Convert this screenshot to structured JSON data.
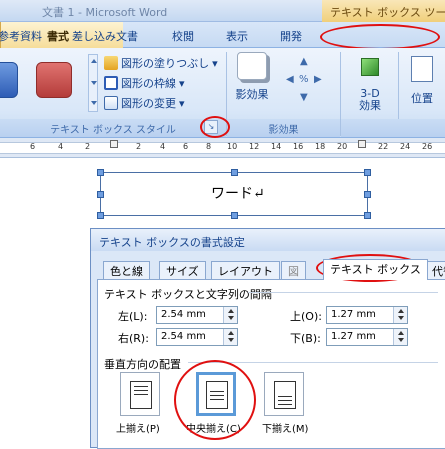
{
  "window": {
    "title": "文書 1 - Microsoft Word",
    "context_tool": "テキスト ボックス ツール"
  },
  "tabs": [
    {
      "label": "参考資料"
    },
    {
      "label": "差し込み文書"
    },
    {
      "label": "校閲"
    },
    {
      "label": "表示"
    },
    {
      "label": "開発"
    },
    {
      "label": "書式"
    }
  ],
  "ribbon": {
    "fill_label": "図形の塗りつぶし",
    "line_label": "図形の枠線",
    "change_label": "図形の変更",
    "shadow_label": "影効果",
    "threed_label1": "3-D",
    "threed_label2": "効果",
    "position_label": "位置",
    "group_style": "テキスト ボックス スタイル",
    "group_shadow": "影効果",
    "swatch_colors": [
      "#3d6fc4",
      "#c8514f"
    ]
  },
  "ruler": {
    "numbers": [
      "6",
      "4",
      "2",
      "2",
      "4",
      "6",
      "8",
      "10",
      "12",
      "14",
      "16",
      "18",
      "20",
      "22",
      "24",
      "26"
    ]
  },
  "document": {
    "textbox_text": "ワード↵"
  },
  "dialog": {
    "title": "テキスト ボックスの書式設定",
    "tabs": [
      "色と線",
      "サイズ",
      "レイアウト",
      "図",
      "テキスト ボックス",
      "代替"
    ],
    "section_margin": "テキスト ボックスと文字列の間隔",
    "left_label": "左(L):",
    "left_value": "2.54 mm",
    "right_label": "右(R):",
    "right_value": "2.54 mm",
    "top_label": "上(O):",
    "top_value": "1.27 mm",
    "bottom_label": "下(B):",
    "bottom_value": "1.27 mm",
    "section_valign": "垂直方向の配置",
    "valign_top": "上揃え(P)",
    "valign_center": "中央揃え(C)",
    "valign_bottom": "下揃え(M)"
  }
}
